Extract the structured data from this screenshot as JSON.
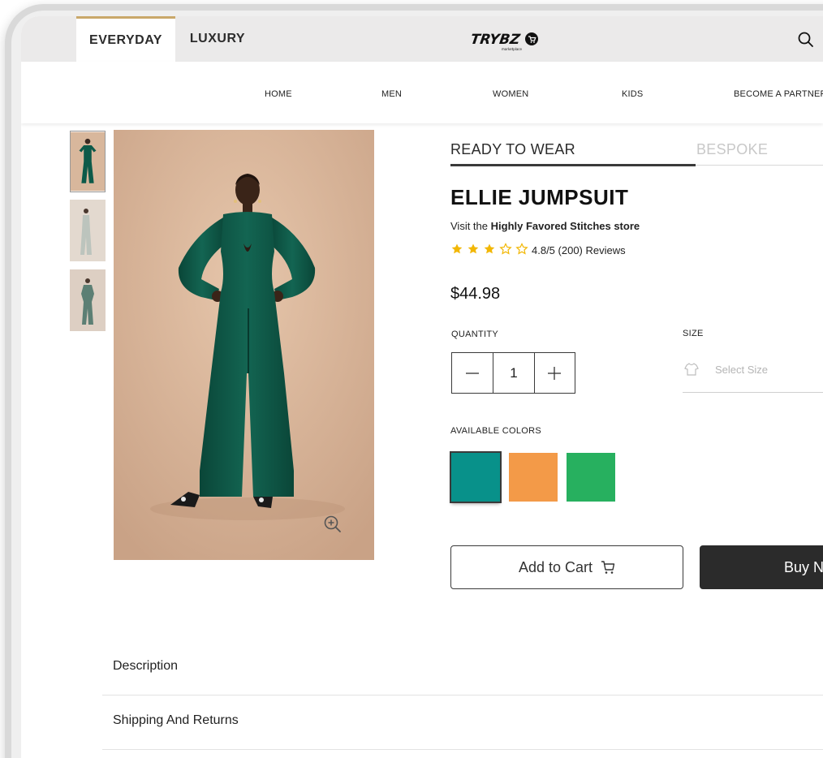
{
  "top_tabs": [
    {
      "label": "EVERYDAY",
      "active": true
    },
    {
      "label": "LUXURY",
      "active": false
    }
  ],
  "brand": {
    "logo_icon": "tryibz-marketplace-logo",
    "logo_text": "TRYBZ",
    "logo_subtext": "marketplace"
  },
  "nav": [
    "HOME",
    "MEN",
    "WOMEN",
    "KIDS",
    "BECOME A PARTNER"
  ],
  "product_tabs": [
    {
      "label": "READY TO WEAR",
      "active": true
    },
    {
      "label": "BESPOKE",
      "active": false
    }
  ],
  "product": {
    "title": "ELLIE JUMPSUIT",
    "store_prefix": "Visit the ",
    "store_name": "Highly Favored Stitches store",
    "rating_stars": 3,
    "rating_max": 5,
    "rating_text": "4.8/5 (200) Reviews",
    "price": "$44.98"
  },
  "quantity": {
    "label": "QUANTITY",
    "value": "1"
  },
  "size": {
    "label": "SIZE",
    "placeholder": "Select Size"
  },
  "colors": {
    "label": "AVAILABLE COLORS",
    "swatches": [
      "#08918a",
      "#f39a48",
      "#27b05f"
    ],
    "selected_index": 0
  },
  "actions": {
    "add_to_cart": "Add to Cart",
    "buy_now": "Buy Now"
  },
  "accordion": [
    "Description",
    "Shipping And Returns"
  ],
  "theme": {
    "accent": "#c9a86a",
    "star": "#f2b705",
    "dark": "#2b2b2b",
    "garment": "#0d5a49",
    "backdrop": "#d9b79a"
  }
}
